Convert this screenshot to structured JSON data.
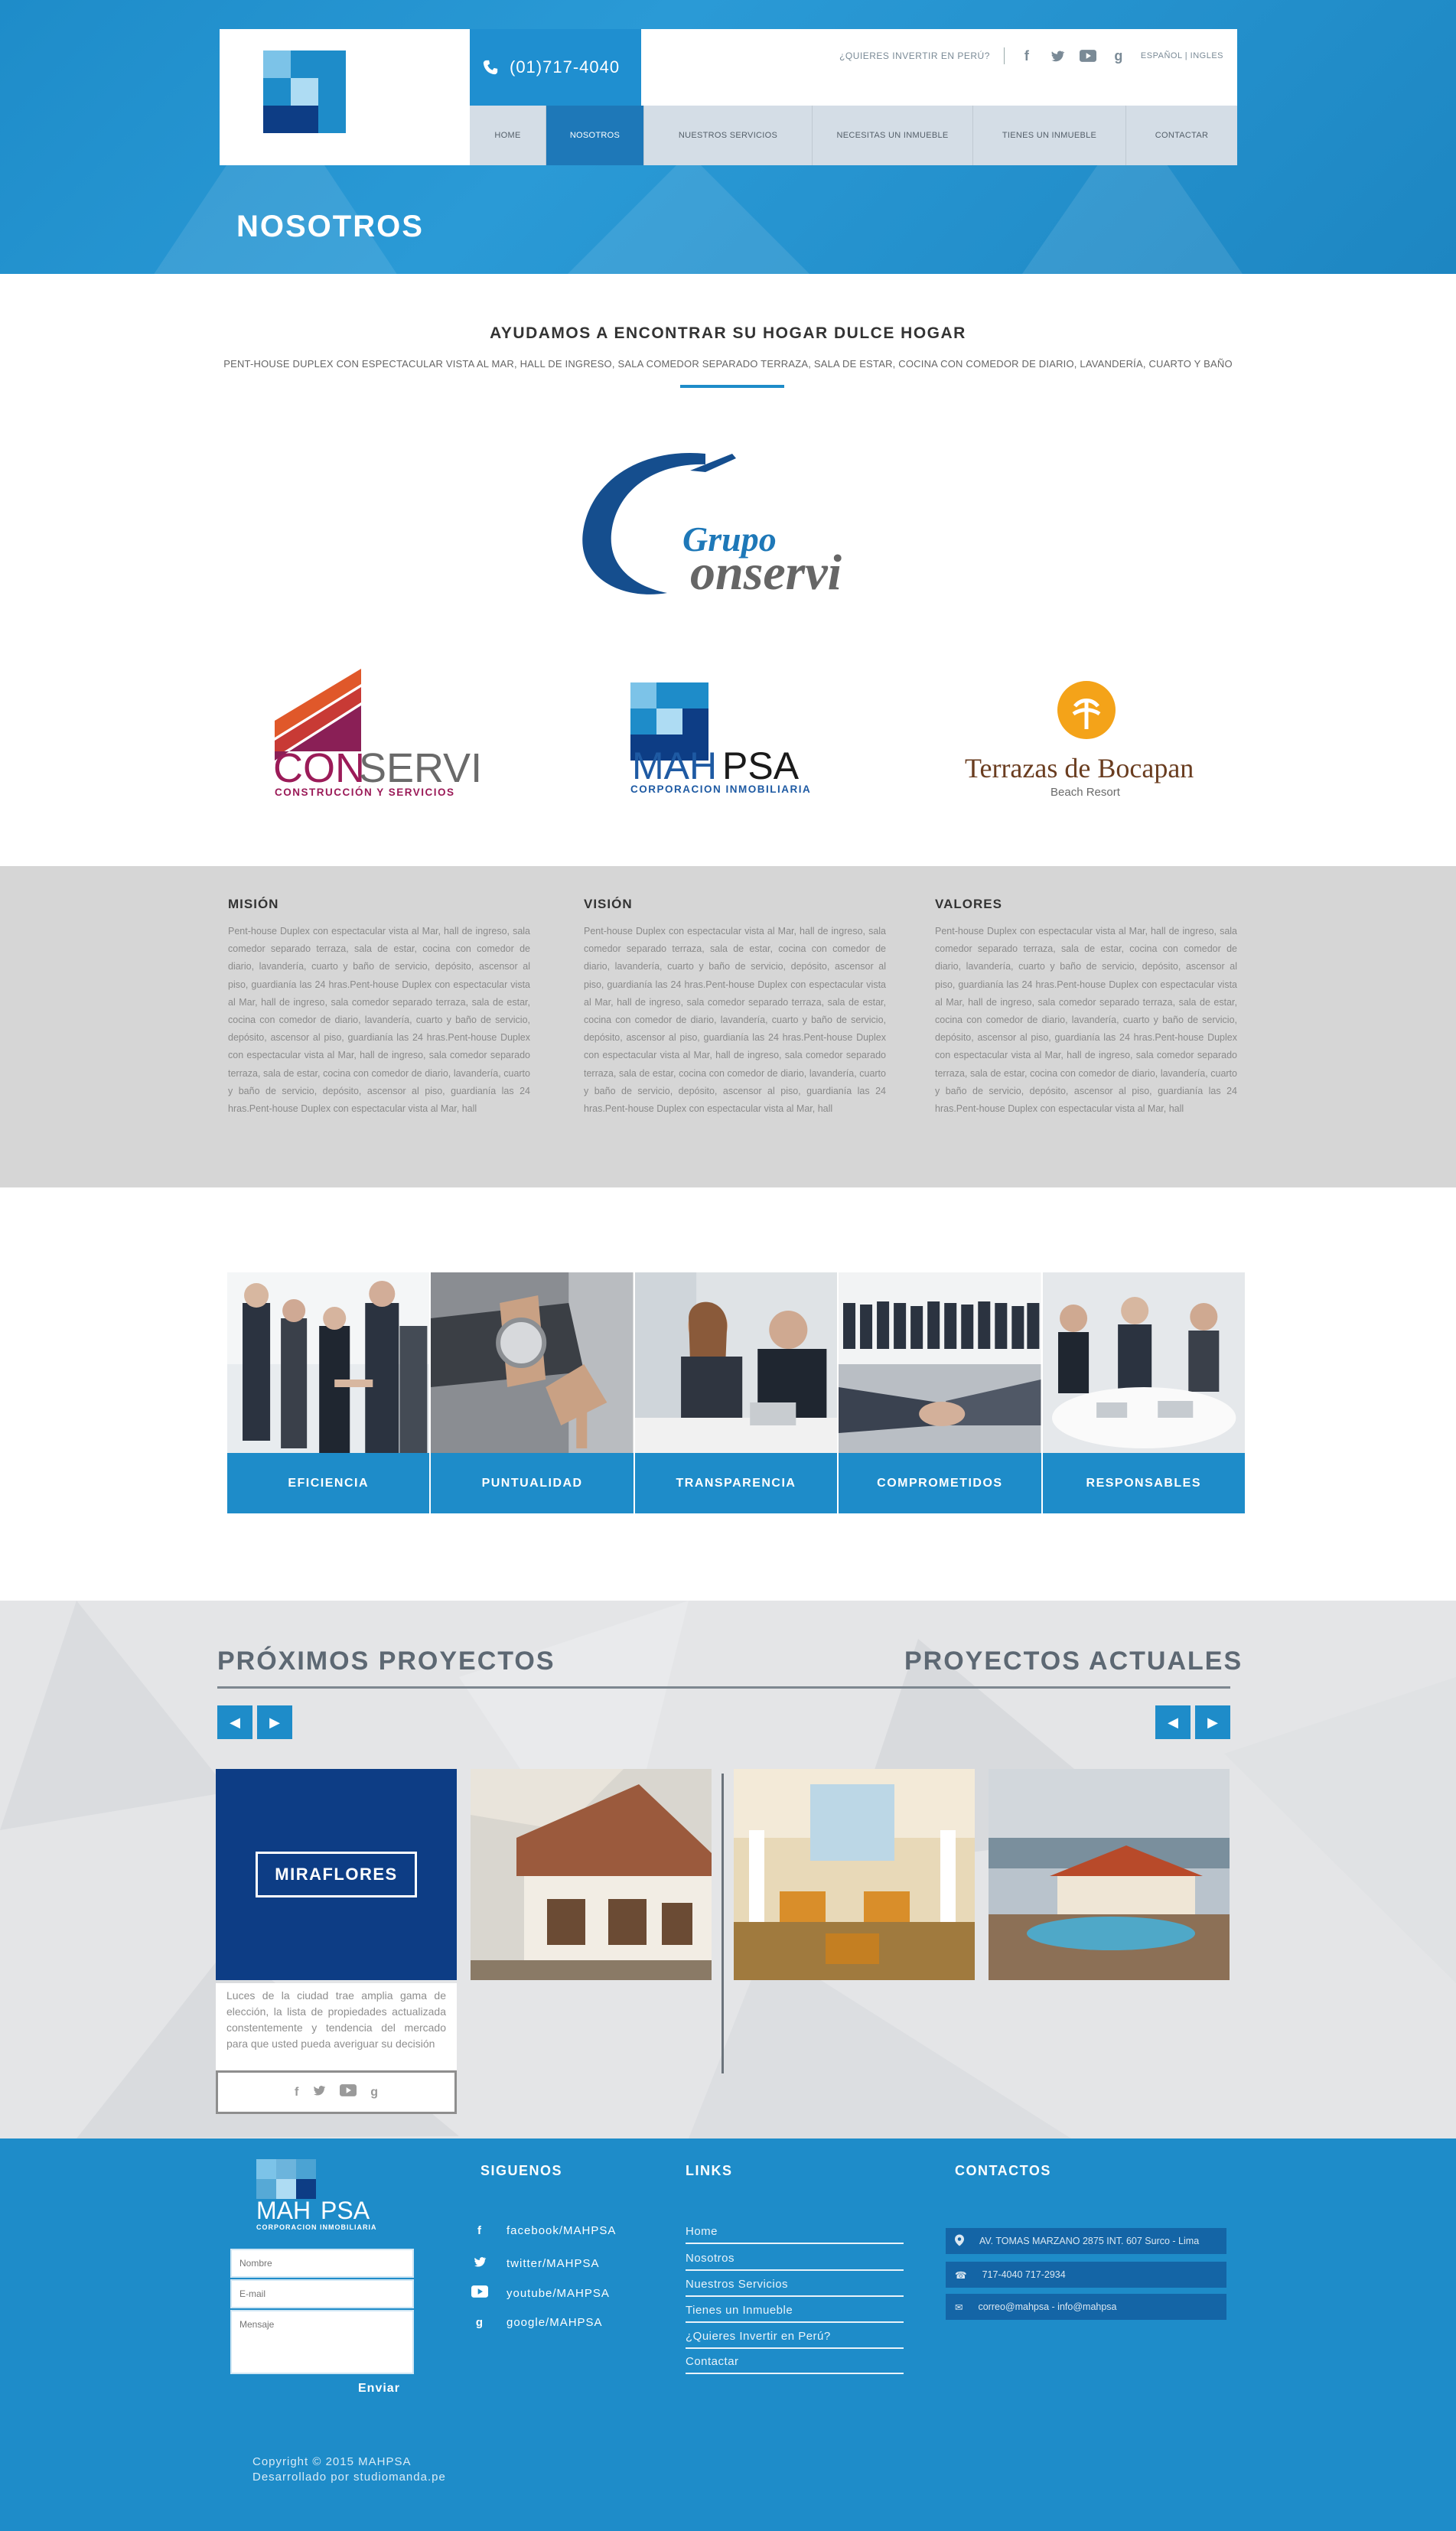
{
  "header": {
    "phone": "(01)717-4040",
    "invest_link": "¿QUIERES INVERTIR EN PERÚ?",
    "lang": {
      "es": "ESPAÑOL",
      "en": "INGLES"
    },
    "nav": [
      "HOME",
      "NOSOTROS",
      "NUESTROS SERVICIOS",
      "NECESITAS UN INMUEBLE",
      "TIENES UN INMUEBLE",
      "CONTACTAR"
    ],
    "page_title": "NOSOTROS"
  },
  "intro": {
    "title": "AYUDAMOS A ENCONTRAR SU HOGAR DULCE HOGAR",
    "subtitle": "PENT-HOUSE DUPLEX CON ESPECTACULAR VISTA AL MAR, HALL DE INGRESO, SALA COMEDOR SEPARADO TERRAZA, SALA DE ESTAR, COCINA CON COMEDOR DE DIARIO, LAVANDERÍA, CUARTO Y BAÑO"
  },
  "brands": {
    "grupo_top": "Grupo",
    "grupo_main": "onservi",
    "conservi_a": "CON",
    "conservi_b": "SERVI",
    "conservi_sub": "CONSTRUCCIÓN Y SERVICIOS",
    "mahpsa_a": "MAH",
    "mahpsa_b": "PSA",
    "mahpsa_sub": "CORPORACION INMOBILIARIA",
    "terrazas": "Terrazas de Bocapan",
    "terrazas_sub": "Beach Resort"
  },
  "mvv": [
    {
      "title": "MISIÓN",
      "text": "Pent-house Duplex con espectacular vista al Mar, hall de ingreso, sala comedor separado terraza, sala de estar, cocina con comedor de diario, lavandería, cuarto y baño de servicio, depósito, ascensor al piso, guardianía las 24 hras.Pent-house Duplex con espectacular vista al Mar, hall de ingreso, sala comedor separado terraza, sala de estar, cocina con comedor de diario, lavandería, cuarto y baño de servicio, depósito, ascensor al piso, guardianía las 24 hras.Pent-house Duplex con espectacular vista al Mar, hall de ingreso, sala comedor separado terraza, sala de estar, cocina con comedor de diario, lavandería, cuarto y baño de servicio, depósito, ascensor al piso, guardianía las 24 hras.Pent-house Duplex con espectacular vista al Mar, hall"
    },
    {
      "title": "VISIÓN",
      "text": "Pent-house Duplex con espectacular vista al Mar, hall de ingreso, sala comedor separado terraza, sala de estar, cocina con comedor de diario, lavandería, cuarto y baño de servicio, depósito, ascensor al piso, guardianía las 24 hras.Pent-house Duplex con espectacular vista al Mar, hall de ingreso, sala comedor separado terraza, sala de estar, cocina con comedor de diario, lavandería, cuarto y baño de servicio, depósito, ascensor al piso, guardianía las 24 hras.Pent-house Duplex con espectacular vista al Mar, hall de ingreso, sala comedor separado terraza, sala de estar, cocina con comedor de diario, lavandería, cuarto y baño de servicio, depósito, ascensor al piso, guardianía las 24 hras.Pent-house Duplex con espectacular vista al Mar, hall"
    },
    {
      "title": "VALORES",
      "text": "Pent-house Duplex con espectacular vista al Mar, hall de ingreso, sala comedor separado terraza, sala de estar, cocina con comedor de diario, lavandería, cuarto y baño de servicio, depósito, ascensor al piso, guardianía las 24 hras.Pent-house Duplex con espectacular vista al Mar, hall de ingreso, sala comedor separado terraza, sala de estar, cocina con comedor de diario, lavandería, cuarto y baño de servicio, depósito, ascensor al piso, guardianía las 24 hras.Pent-house Duplex con espectacular vista al Mar, hall de ingreso, sala comedor separado terraza, sala de estar, cocina con comedor de diario, lavandería, cuarto y baño de servicio, depósito, ascensor al piso, guardianía las 24 hras.Pent-house Duplex con espectacular vista al Mar, hall"
    }
  ],
  "values": [
    "EFICIENCIA",
    "PUNTUALIDAD",
    "TRANSPARENCIA",
    "COMPROMETIDOS",
    "RESPONSABLES"
  ],
  "projects": {
    "upcoming_title": "PRÓXIMOS PROYECTOS",
    "current_title": "PROYECTOS ACTUALES",
    "miraflores_label": "MIRAFLORES",
    "miraflores_desc": "Luces de la ciudad trae amplia gama de elección, la lista de propiedades actualizada constentemente y tendencia del mercado para que usted pueda averiguar su decisión"
  },
  "footer": {
    "logo_a": "MAH",
    "logo_b": "PSA",
    "logo_sub": "CORPORACION INMOBILIARIA",
    "form": {
      "name": "Nombre",
      "email": "E-mail",
      "message": "Mensaje",
      "send": "Enviar"
    },
    "social_title": "SIGUENOS",
    "social": [
      "facebook/MAHPSA",
      "twitter/MAHPSA",
      "youtube/MAHPSA",
      "google/MAHPSA"
    ],
    "links_title": "LINKS",
    "links": [
      "Home",
      "Nosotros",
      "Nuestros Servicios",
      "Tienes un Inmueble",
      "¿Quieres Invertir en Perú?",
      "Contactar"
    ],
    "contacts_title": "CONTACTOS",
    "contacts": [
      "AV. TOMAS MARZANO 2875 INT. 607 Surco - Lima",
      "717-4040 717-2934",
      "correo@mahpsa - info@mahpsa"
    ],
    "copyright": "Copyright © 2015 MAHPSA",
    "developer": "Desarrollado por studiomanda.pe"
  },
  "colors": {
    "primary": "#1e8cc9",
    "nav_active": "#1e78b8",
    "dark_blue": "#0d3d85",
    "gray_band": "#d6d6d6"
  }
}
